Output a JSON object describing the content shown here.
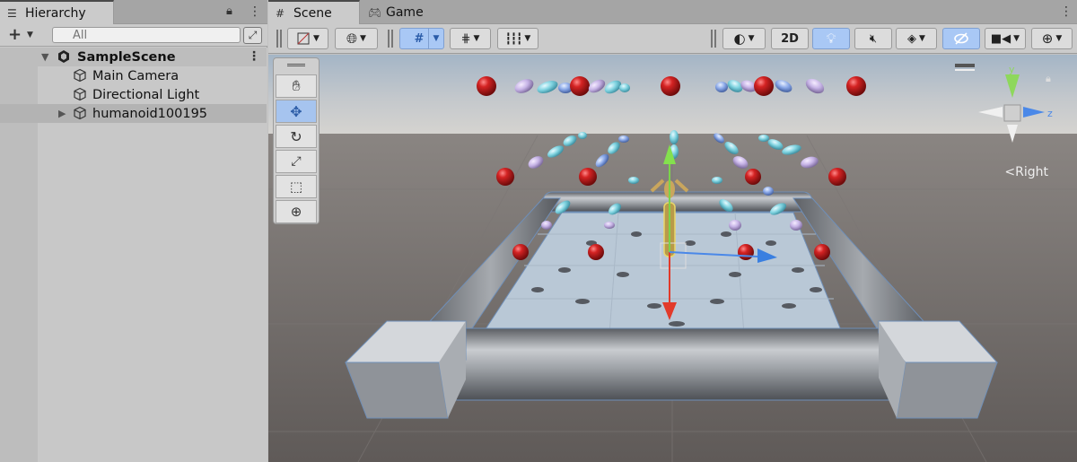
{
  "hierarchy": {
    "tab_label": "Hierarchy",
    "search_placeholder": "All",
    "scene_name": "SampleScene",
    "items": [
      {
        "label": "Main Camera"
      },
      {
        "label": "Directional Light"
      },
      {
        "label": "humanoid100195"
      }
    ]
  },
  "scene_view": {
    "tabs": [
      {
        "label": "Scene",
        "icon": "grid-icon"
      },
      {
        "label": "Game",
        "icon": "gamepad-icon"
      }
    ],
    "toolbar": {
      "mode_2d": "2D"
    },
    "orientation_label": "Right"
  },
  "colors": {
    "selection_blue": "#a9c8f5",
    "sky_top": "#a7b7c6",
    "ground": "#6e6967",
    "ball_red": "#c81c1c"
  }
}
